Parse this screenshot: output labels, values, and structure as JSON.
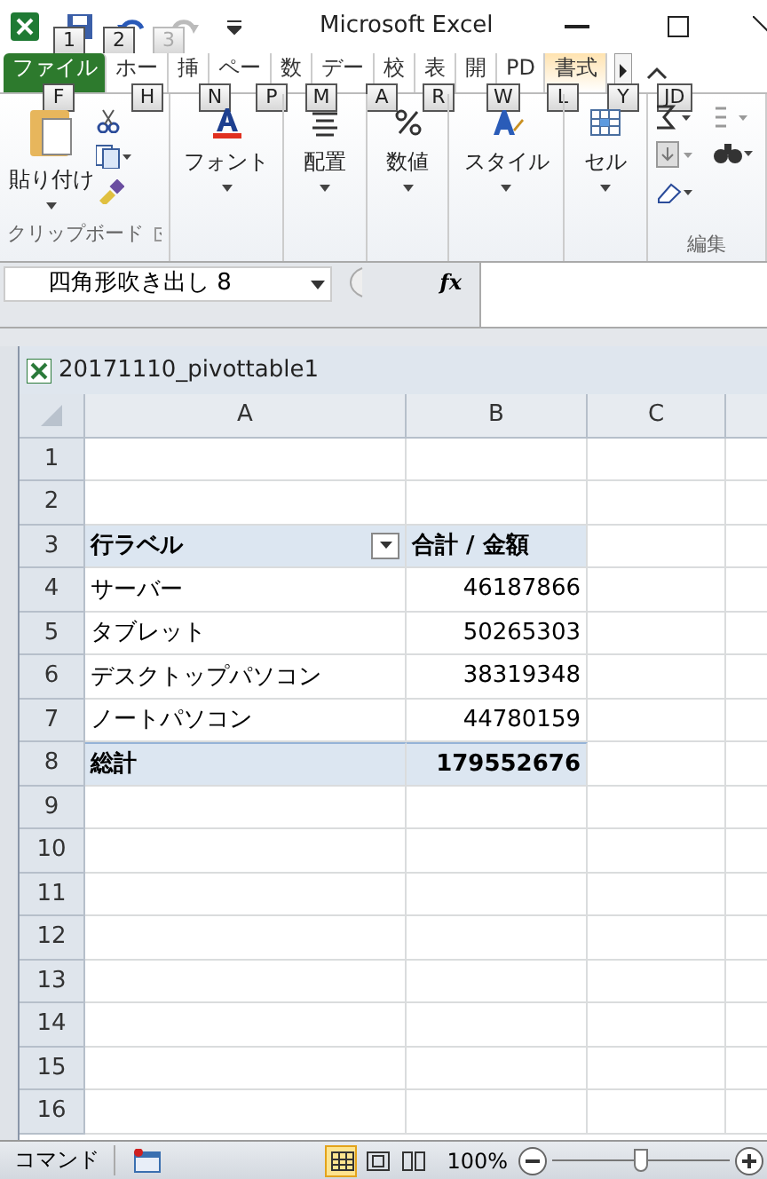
{
  "title_bar": {
    "title": "Microsoft Excel",
    "keytips": [
      {
        "label": "1",
        "disabled": false
      },
      {
        "label": "2",
        "disabled": false
      },
      {
        "label": "3",
        "disabled": true
      }
    ]
  },
  "ribbon_tabs": [
    {
      "label": "ファイル",
      "keytip": "F",
      "selected": true,
      "kind": "file"
    },
    {
      "label": "ホー",
      "keytip": "H",
      "selected": false,
      "kind": "tab"
    },
    {
      "label": "挿",
      "keytip": "N",
      "selected": false,
      "kind": "tab"
    },
    {
      "label": "ペー",
      "keytip": "P",
      "selected": false,
      "kind": "tab"
    },
    {
      "label": "数",
      "keytip": "M",
      "selected": false,
      "kind": "tab"
    },
    {
      "label": "デー",
      "keytip": "A",
      "selected": false,
      "kind": "tab"
    },
    {
      "label": "校",
      "keytip": "R",
      "selected": false,
      "kind": "tab"
    },
    {
      "label": "表",
      "keytip": "W",
      "selected": false,
      "kind": "tab"
    },
    {
      "label": "開",
      "keytip": "L",
      "selected": false,
      "kind": "tab"
    },
    {
      "label": "PD",
      "keytip": "Y",
      "selected": false,
      "kind": "tab"
    },
    {
      "label": "書式",
      "keytip": "JD",
      "selected": false,
      "kind": "context"
    }
  ],
  "clipboard": {
    "paste": "貼り付け",
    "label": "クリップボード"
  },
  "ribbon_buttons": [
    {
      "label": "フォント",
      "kind": "font"
    },
    {
      "label": "配置",
      "kind": "align"
    },
    {
      "label": "数値",
      "kind": "number"
    },
    {
      "label": "スタイル",
      "kind": "style"
    },
    {
      "label": "セル",
      "kind": "cells"
    }
  ],
  "editing": {
    "label": "編集"
  },
  "name_box": {
    "value": "四角形吹き出し 8"
  },
  "formula_bar": {
    "fx": "fx"
  },
  "workbook": {
    "title": "20171110_pivottable1",
    "columns": [
      "A",
      "B",
      "C"
    ],
    "rows": [
      {
        "number": "1",
        "kind": "empty"
      },
      {
        "number": "2",
        "kind": "empty"
      },
      {
        "number": "3",
        "kind": "header",
        "label": "行ラベル",
        "value": "合計 / 金額"
      },
      {
        "number": "4",
        "kind": "item",
        "label": "サーバー",
        "value": "46187866"
      },
      {
        "number": "5",
        "kind": "item",
        "label": "タブレット",
        "value": "50265303"
      },
      {
        "number": "6",
        "kind": "item",
        "label": "デスクトップパソコン",
        "value": "38319348"
      },
      {
        "number": "7",
        "kind": "item",
        "label": "ノートパソコン",
        "value": "44780159"
      },
      {
        "number": "8",
        "kind": "total",
        "label": "総計",
        "value": "179552676"
      },
      {
        "number": "9",
        "kind": "empty"
      },
      {
        "number": "10",
        "kind": "empty"
      },
      {
        "number": "11",
        "kind": "empty"
      },
      {
        "number": "12",
        "kind": "empty"
      },
      {
        "number": "13",
        "kind": "empty"
      },
      {
        "number": "14",
        "kind": "empty"
      },
      {
        "number": "15",
        "kind": "empty"
      },
      {
        "number": "16",
        "kind": "empty"
      }
    ]
  },
  "status_bar": {
    "mode": "コマンド",
    "views": [
      {
        "kind": "normal",
        "selected": true
      },
      {
        "kind": "layout",
        "selected": false
      },
      {
        "kind": "pagebreak",
        "selected": false
      }
    ],
    "zoom": "100%",
    "zoom_slider": {
      "level": 0.5
    }
  }
}
